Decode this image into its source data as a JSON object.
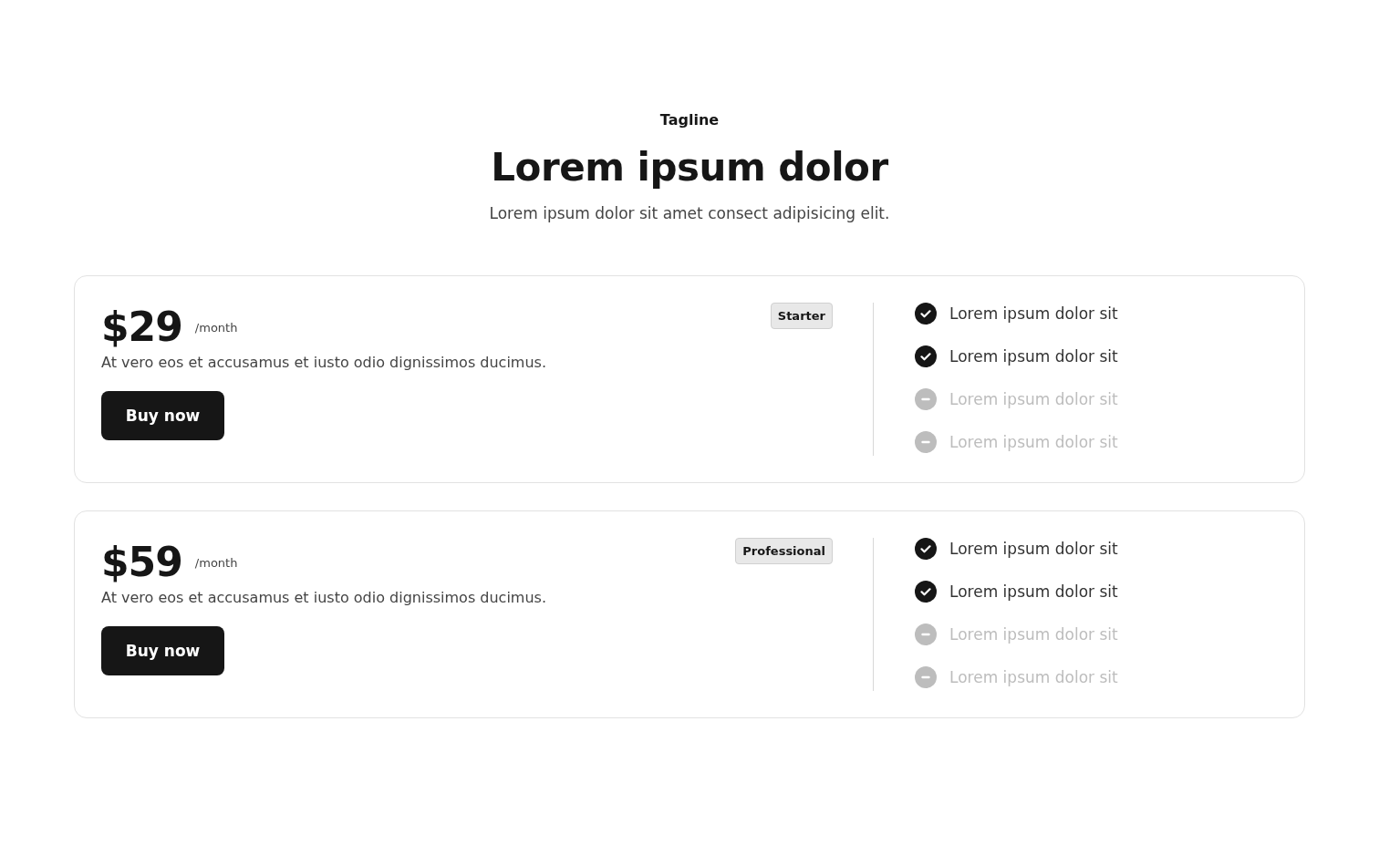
{
  "header": {
    "tagline": "Tagline",
    "title": "Lorem ipsum dolor",
    "subtitle": "Lorem ipsum dolor sit amet consect adipisicing elit."
  },
  "plans": [
    {
      "price": "$29",
      "period": "/month",
      "badge": "Starter",
      "description": "At vero eos et accusamus et iusto odio dignissimos ducimus.",
      "button": "Buy now",
      "features": [
        {
          "text": "Lorem ipsum dolor sit",
          "included": true
        },
        {
          "text": "Lorem ipsum dolor sit",
          "included": true
        },
        {
          "text": "Lorem ipsum dolor sit",
          "included": false
        },
        {
          "text": "Lorem ipsum dolor sit",
          "included": false
        }
      ]
    },
    {
      "price": "$59",
      "period": "/month",
      "badge": "Professional",
      "description": "At vero eos et accusamus et iusto odio dignissimos ducimus.",
      "button": "Buy now",
      "features": [
        {
          "text": "Lorem ipsum dolor sit",
          "included": true
        },
        {
          "text": "Lorem ipsum dolor sit",
          "included": true
        },
        {
          "text": "Lorem ipsum dolor sit",
          "included": false
        },
        {
          "text": "Lorem ipsum dolor sit",
          "included": false
        }
      ]
    }
  ]
}
